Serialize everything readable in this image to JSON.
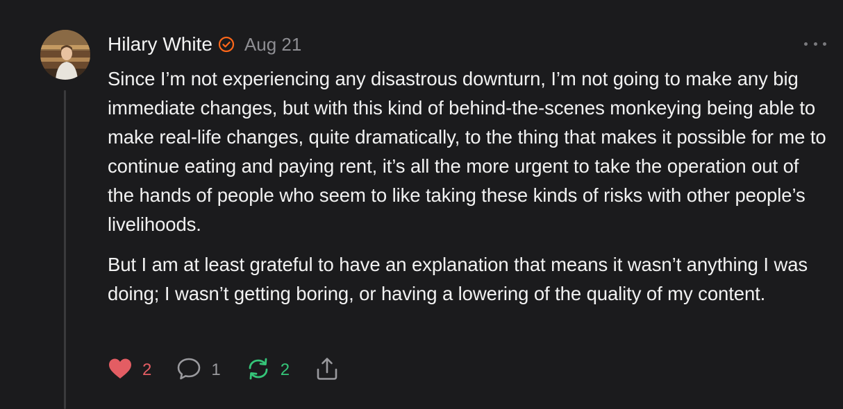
{
  "post": {
    "author": "Hilary White",
    "date": "Aug 21",
    "paragraphs": [
      "Since I’m not experiencing any disastrous downturn, I’m not going to make any big immediate changes, but with this kind of behind-the-scenes monkeying being able to make real-life changes, quite dramatically, to the thing that makes it possible for me to continue eating and paying rent, it’s all the more urgent to take the operation out of the hands of people who seem to like taking these kinds of risks with other people’s livelihoods.",
      "But I am at least grateful to have an explanation that means it wasn’t anything I was doing; I wasn’t getting boring, or having a lowering of the quality of my content."
    ]
  },
  "actions": {
    "likes": "2",
    "comments": "1",
    "restacks": "2"
  },
  "icons": {
    "verified": "verified-check-icon",
    "like": "heart-icon",
    "comment": "comment-bubble-icon",
    "restack": "restack-icon",
    "share": "share-icon",
    "more": "more-dots-icon"
  },
  "colors": {
    "background": "#1b1b1d",
    "verified": "#ff6719",
    "like": "#e35d63",
    "restack": "#35c679",
    "muted": "#8e8e93"
  }
}
